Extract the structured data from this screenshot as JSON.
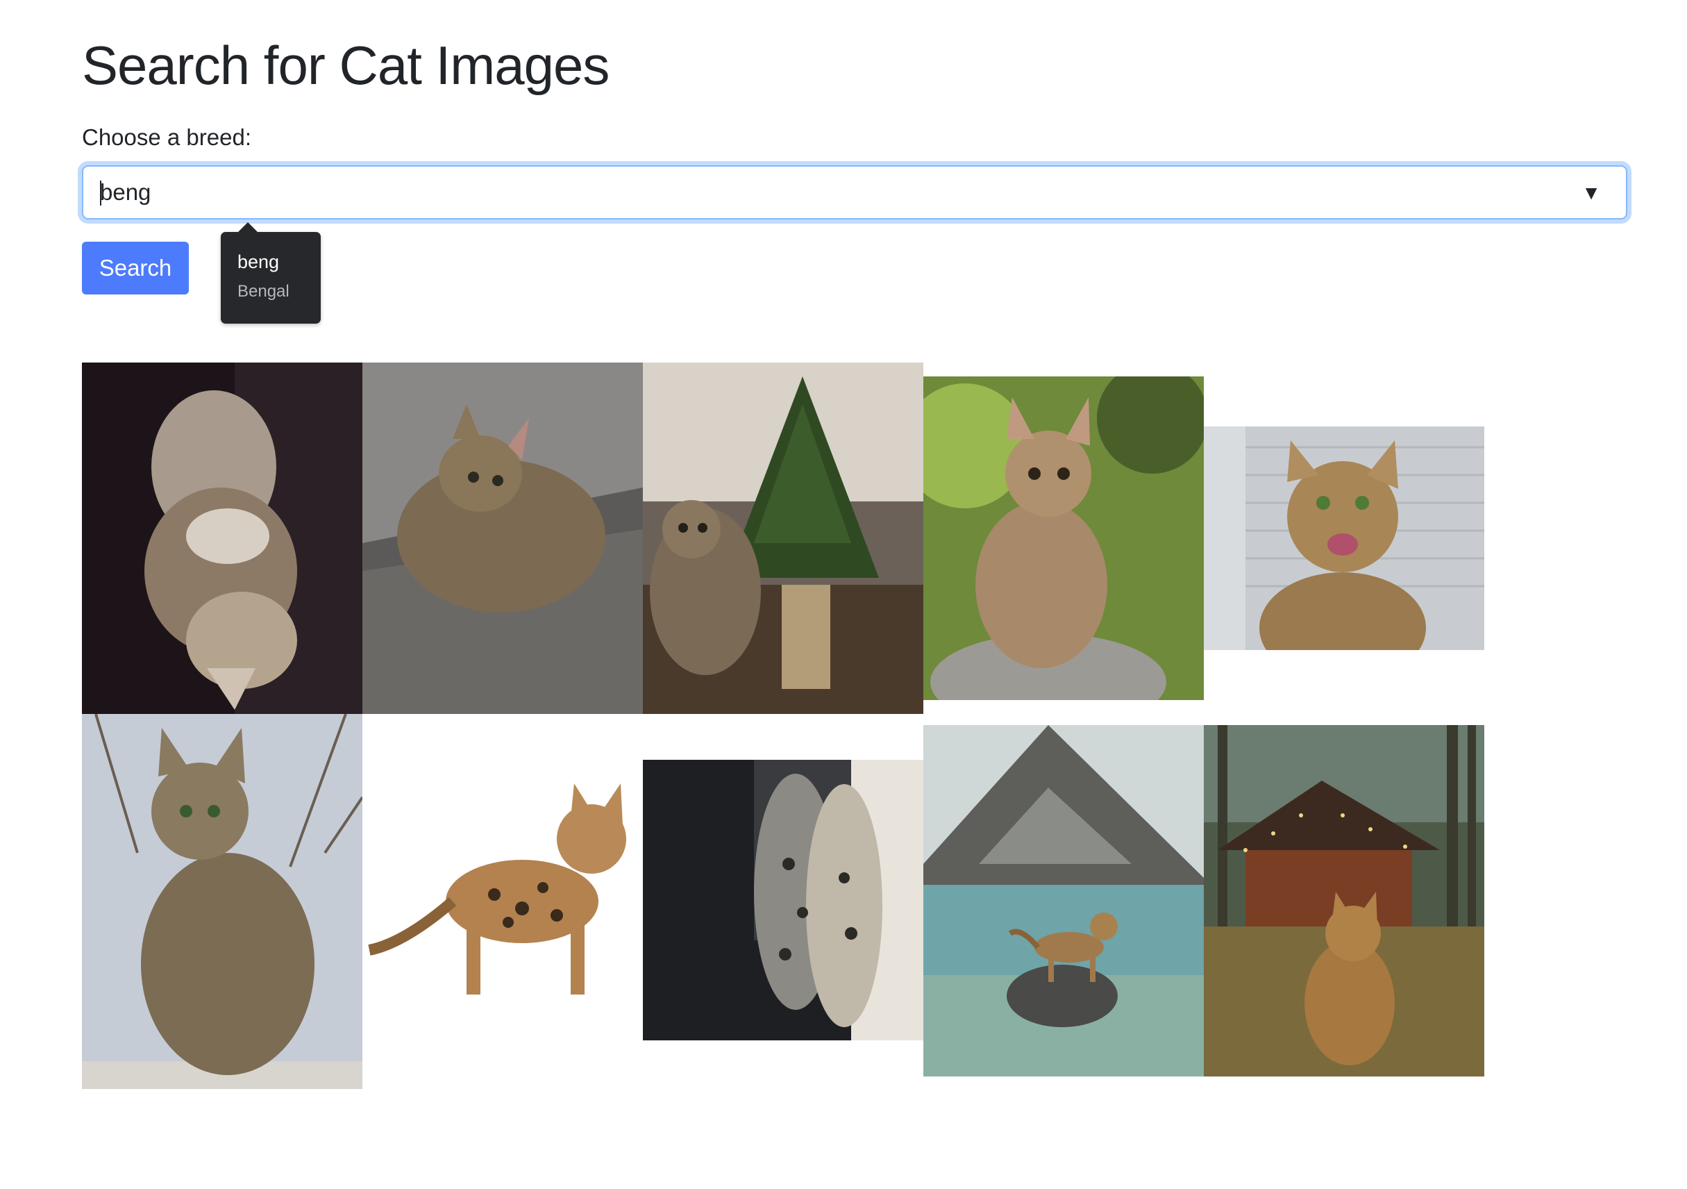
{
  "page": {
    "title": "Search for Cat Images",
    "breed_label": "Choose a breed:"
  },
  "breed_input": {
    "value": "beng",
    "dropdown_icon": "caret-down-icon"
  },
  "search_button": {
    "label": "Search"
  },
  "suggestion": {
    "value": "beng",
    "label": "Bengal"
  },
  "gallery": {
    "images": [
      {
        "name": "cat-photo-1",
        "subject": "tabby kitten lying upside down on dark fabric"
      },
      {
        "name": "cat-photo-2",
        "subject": "tabby kitten lying on furry blanket"
      },
      {
        "name": "cat-photo-3",
        "subject": "cat sitting next to small potted pine tree"
      },
      {
        "name": "cat-photo-4",
        "subject": "bengal kitten sitting on a rock"
      },
      {
        "name": "cat-photo-5",
        "subject": "bengal cat licking lips by window"
      },
      {
        "name": "cat-photo-6",
        "subject": "tabby cat sitting on wall with branches"
      },
      {
        "name": "cat-photo-7",
        "subject": "spotted bengal cat standing on white background"
      },
      {
        "name": "cat-photo-8",
        "subject": "two spotted cats looking out a window"
      },
      {
        "name": "cat-photo-9",
        "subject": "bengal cat standing on rock in mountain lake"
      },
      {
        "name": "cat-photo-10",
        "subject": "bengal cat sitting in front of wooden cabin"
      }
    ]
  },
  "colors": {
    "focus_border": "#86b7fe",
    "primary_button": "#4c7bfd",
    "tooltip_bg": "#26282c"
  }
}
